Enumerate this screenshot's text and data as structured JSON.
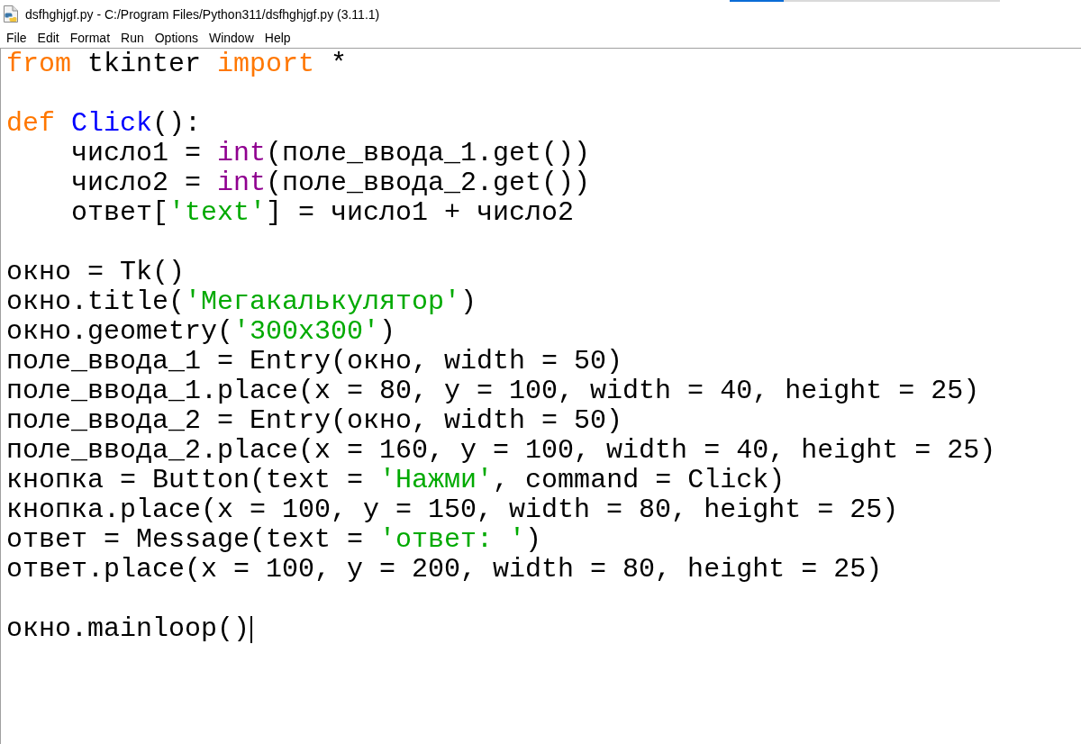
{
  "window": {
    "title": "dsfhghjgf.py - C:/Program Files/Python311/dsfhghjgf.py (3.11.1)",
    "progress": {
      "level": 0.2
    }
  },
  "menu": [
    "File",
    "Edit",
    "Format",
    "Run",
    "Options",
    "Window",
    "Help"
  ],
  "editor": {
    "lines": [
      {
        "kind": "code",
        "tokens": [
          {
            "text": "from",
            "kind": "keyword"
          },
          {
            "text": " tkinter ",
            "kind": "plain"
          },
          {
            "text": "import",
            "kind": "keyword"
          },
          {
            "text": " *",
            "kind": "plain"
          }
        ]
      },
      {
        "kind": "blank"
      },
      {
        "kind": "code",
        "tokens": [
          {
            "text": "def ",
            "kind": "keyword"
          },
          {
            "text": "Click",
            "kind": "definition"
          },
          {
            "text": "():",
            "kind": "plain"
          }
        ],
        "children": [
          {
            "kind": "code",
            "tokens": [
              {
                "text": "число1 = ",
                "kind": "plain"
              },
              {
                "text": "int",
                "kind": "builtin"
              },
              {
                "text": "(поле_ввода_1.get())",
                "kind": "plain"
              }
            ]
          },
          {
            "kind": "code",
            "tokens": [
              {
                "text": "число2 = ",
                "kind": "plain"
              },
              {
                "text": "int",
                "kind": "builtin"
              },
              {
                "text": "(поле_ввода_2.get())",
                "kind": "plain"
              }
            ]
          },
          {
            "kind": "code",
            "tokens": [
              {
                "text": "ответ[",
                "kind": "plain"
              },
              {
                "text": "'text'",
                "kind": "string"
              },
              {
                "text": "] = число1 + число2",
                "kind": "plain"
              }
            ]
          }
        ]
      },
      {
        "kind": "blank"
      },
      {
        "kind": "code",
        "tokens": [
          {
            "text": "окно = Tk()",
            "kind": "plain"
          }
        ]
      },
      {
        "kind": "code",
        "tokens": [
          {
            "text": "окно.title(",
            "kind": "plain"
          },
          {
            "text": "'Мегакалькулятор'",
            "kind": "string"
          },
          {
            "text": ")",
            "kind": "plain"
          }
        ]
      },
      {
        "kind": "code",
        "tokens": [
          {
            "text": "окно.geometry(",
            "kind": "plain"
          },
          {
            "text": "'300x300'",
            "kind": "string"
          },
          {
            "text": ")",
            "kind": "plain"
          }
        ]
      },
      {
        "kind": "code",
        "tokens": [
          {
            "text": "поле_ввода_1 = Entry(окно, width = 50)",
            "kind": "plain"
          }
        ]
      },
      {
        "kind": "code",
        "tokens": [
          {
            "text": "поле_ввода_1.place(x = 80, y = 100, width = 40, height = 25)",
            "kind": "plain"
          }
        ]
      },
      {
        "kind": "code",
        "tokens": [
          {
            "text": "поле_ввода_2 = Entry(окно, width = 50)",
            "kind": "plain"
          }
        ]
      },
      {
        "kind": "code",
        "tokens": [
          {
            "text": "поле_ввода_2.place(x = 160, y = 100, width = 40, height = 25)",
            "kind": "plain"
          }
        ]
      },
      {
        "kind": "code",
        "tokens": [
          {
            "text": "кнопка = Button(text = ",
            "kind": "plain"
          },
          {
            "text": "'Нажми'",
            "kind": "string"
          },
          {
            "text": ", command = Click)",
            "kind": "plain"
          }
        ]
      },
      {
        "kind": "code",
        "tokens": [
          {
            "text": "кнопка.place(x = 100, y = 150, width = 80, height = 25)",
            "kind": "plain"
          }
        ]
      },
      {
        "kind": "code",
        "tokens": [
          {
            "text": "ответ = Message(text = ",
            "kind": "plain"
          },
          {
            "text": "'ответ: '",
            "kind": "string"
          },
          {
            "text": ")",
            "kind": "plain"
          }
        ]
      },
      {
        "kind": "code",
        "tokens": [
          {
            "text": "ответ.place(x = 100, y = 200, width = 80, height = 25)",
            "kind": "plain"
          }
        ]
      },
      {
        "kind": "blank"
      },
      {
        "kind": "code",
        "tokens": [
          {
            "text": "окно.mainloop()",
            "kind": "plain"
          }
        ],
        "cursor": true
      }
    ]
  }
}
